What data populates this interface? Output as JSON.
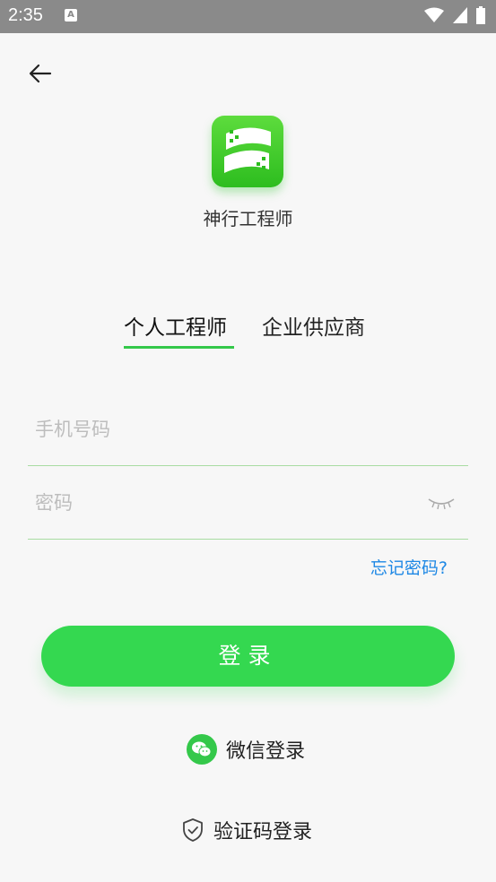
{
  "status_bar": {
    "time": "2:35",
    "notification_letter": "A"
  },
  "app": {
    "name": "神行工程师"
  },
  "tabs": [
    {
      "label": "个人工程师",
      "active": true
    },
    {
      "label": "企业供应商",
      "active": false
    }
  ],
  "form": {
    "phone_placeholder": "手机号码",
    "password_placeholder": "密码",
    "forgot_label": "忘记密码?"
  },
  "login_button": "登录",
  "alt_logins": {
    "wechat": "微信登录",
    "sms": "验证码登录"
  },
  "colors": {
    "accent": "#34d850",
    "link": "#1e88e5",
    "status_bar": "#8a8a8a"
  }
}
